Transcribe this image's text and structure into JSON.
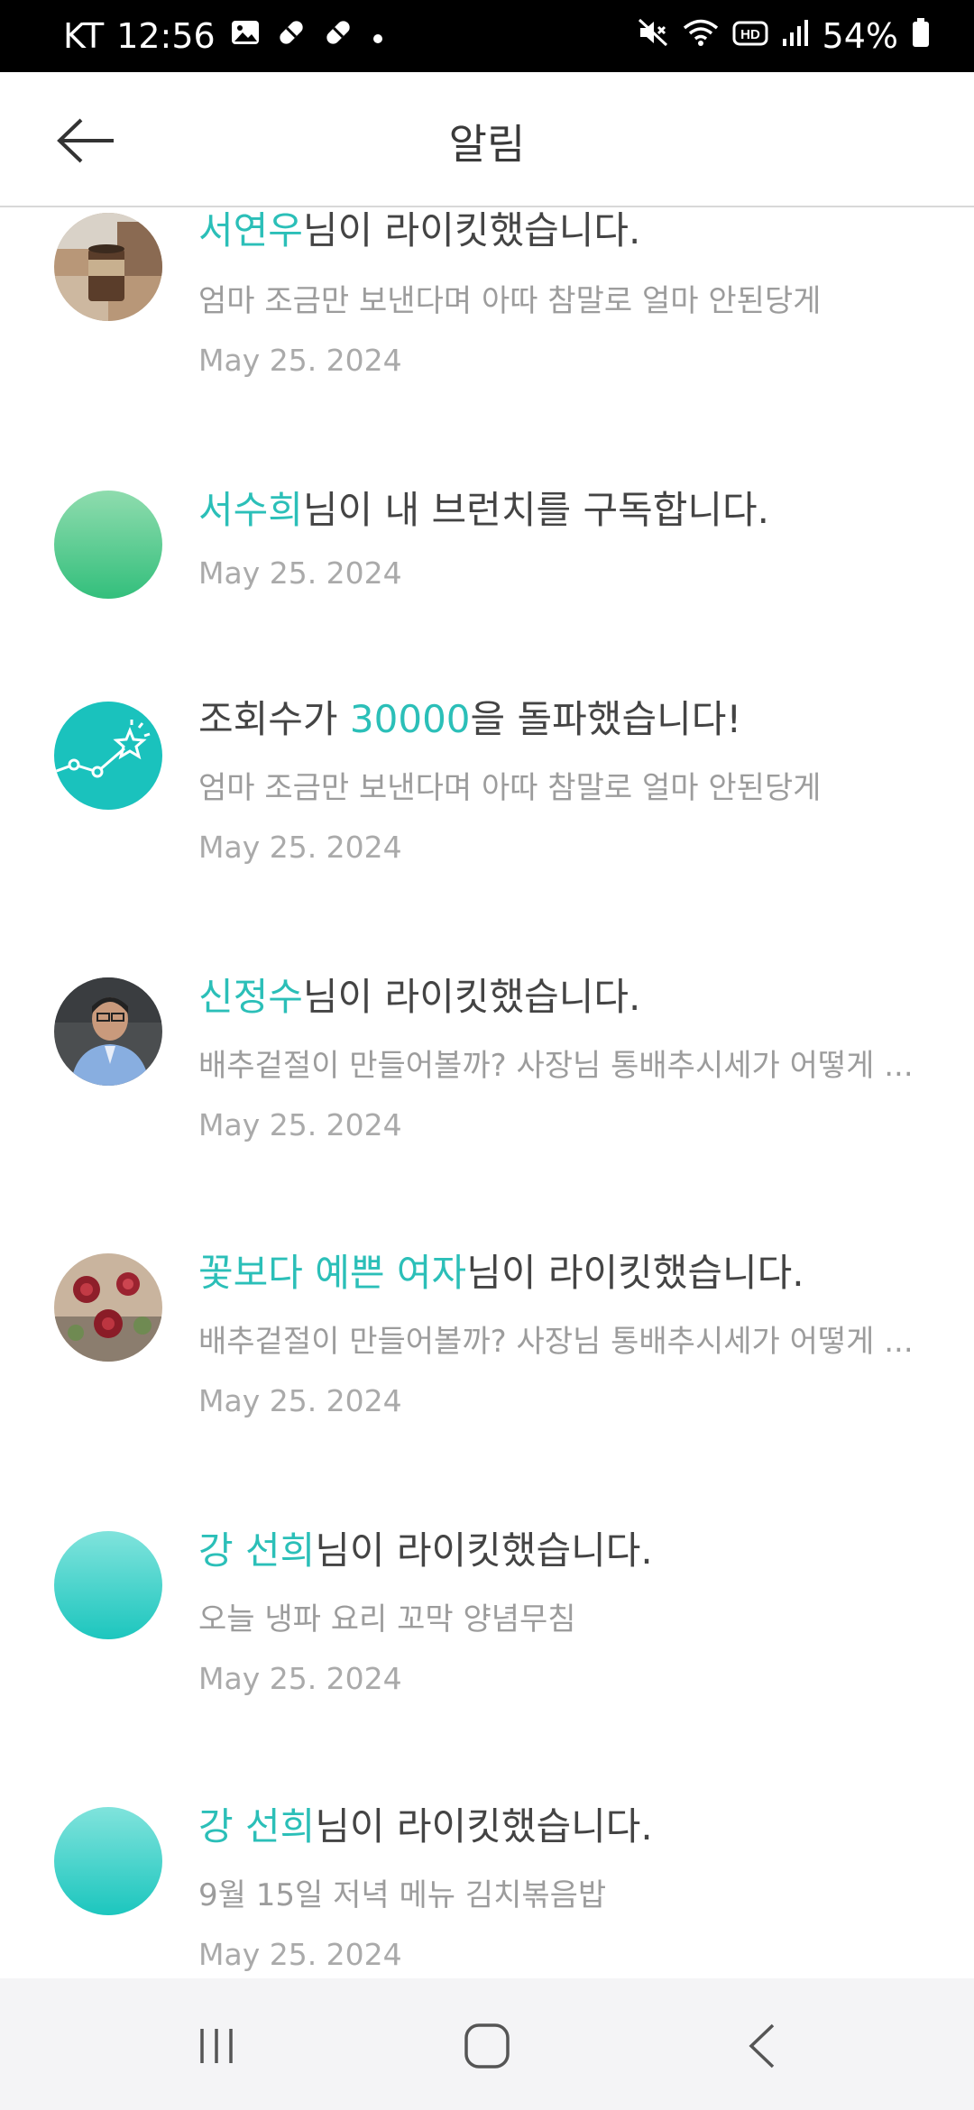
{
  "status_bar": {
    "carrier": "KT",
    "time": "12:56",
    "battery": "54%",
    "left_icons": [
      "image-icon",
      "pill-icon",
      "pill-icon",
      "dot-icon"
    ],
    "right_icons": [
      "mute-icon",
      "wifi-icon",
      "hd-icon",
      "signal-icon",
      "battery-icon"
    ]
  },
  "header": {
    "title": "알림",
    "back_icon": "arrow-left-icon"
  },
  "notifications": [
    {
      "avatar": "photo-coffee",
      "name": "서연우",
      "suffix": "님이 라이킷했습니다.",
      "subtitle": "엄마 조금만 보낸다며 아따 참말로 얼마 안된당게",
      "date": "May 25. 2024"
    },
    {
      "avatar": "gradient-green",
      "name": "서수희",
      "suffix": "님이 내 브런치를 구독합니다.",
      "date": "May 25. 2024"
    },
    {
      "avatar": "stat-chart-icon",
      "prefix": "조회수가 ",
      "number": "30000",
      "suffix": "을 돌파했습니다!",
      "subtitle": "엄마 조금만 보낸다며 아따 참말로 얼마 안된당게",
      "date": "May 25. 2024"
    },
    {
      "avatar": "photo-man",
      "name": "신정수",
      "suffix": "님이 라이킷했습니다.",
      "subtitle": "배추겉절이 만들어볼까? 사장님 통배추시세가 어떻게 ...",
      "date": "May 25. 2024"
    },
    {
      "avatar": "photo-roses",
      "name": "꽃보다 예쁜 여자",
      "suffix": "님이 라이킷했습니다.",
      "subtitle": "배추겉절이 만들어볼까? 사장님 통배추시세가 어떻게 ...",
      "date": "May 25. 2024"
    },
    {
      "avatar": "gradient-teal",
      "name": "강 선희",
      "suffix": "님이 라이킷했습니다.",
      "subtitle": "오늘 냉파 요리 꼬막 양념무침",
      "date": "May 25. 2024"
    },
    {
      "avatar": "gradient-teal",
      "name": "강 선희",
      "suffix": "님이 라이킷했습니다.",
      "subtitle": "9월 15일 저녁 메뉴 김치볶음밥",
      "date": "May 25. 2024"
    }
  ],
  "nav_bar": {
    "buttons": [
      "recent-apps-icon",
      "home-icon",
      "back-icon"
    ]
  },
  "colors": {
    "accent": "#2bbfb8",
    "status_bar_bg": "#000000",
    "nav_bar_bg": "#f4f4f6"
  }
}
